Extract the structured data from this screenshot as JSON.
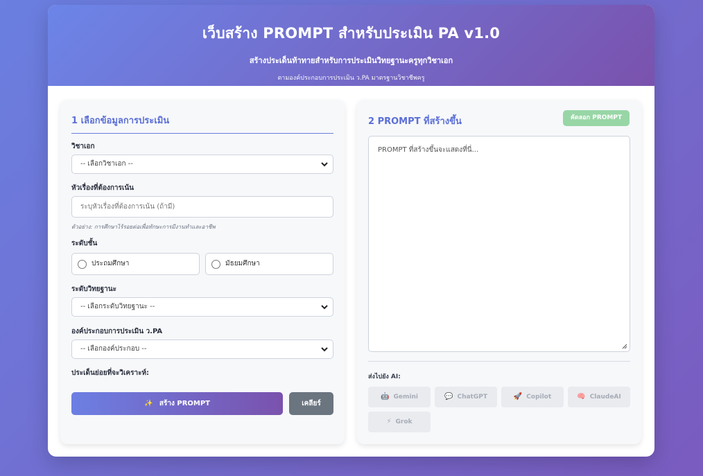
{
  "header": {
    "title": "เว็บสร้าง PROMPT สำหรับประเมิน PA v1.0",
    "subtitle": "สร้างประเด็นท้าทายสำหรับการประเมินวิทยฐานะครูทุกวิชาเอก",
    "description": "ตามองค์ประกอบการประเมิน ว.PA มาตรฐานวิชาชีพครู"
  },
  "form": {
    "section_title": "1 เลือกข้อมูลการประเมิน",
    "subject": {
      "label": "วิชาเอก",
      "value": "-- เลือกวิชาเอก --"
    },
    "topic": {
      "label": "หัวเรื่องที่ต้องการเน้น",
      "placeholder": "ระบุหัวเรื่องที่ต้องการเน้น (ถ้ามี)",
      "hint": "ตัวอย่าง: การศึกษาไร้รอยต่อเพื่อทักษะการมีงานทำและอาชีพ"
    },
    "level": {
      "label": "ระดับชั้น",
      "options": [
        "ประถมศึกษา",
        "มัธยมศึกษา"
      ]
    },
    "rank": {
      "label": "ระดับวิทยฐานะ",
      "value": "-- เลือกระดับวิทยฐานะ --"
    },
    "component": {
      "label": "องค์ประกอบการประเมิน ว.PA",
      "value": "-- เลือกองค์ประกอบ --"
    },
    "subtopics_label": "ประเด็นย่อยที่จะวิเคราะห์:",
    "generate_button": "สร้าง PROMPT",
    "generate_icon": "✨",
    "clear_button": "เคลียร์"
  },
  "output": {
    "section_title": "2 PROMPT ที่สร้างขึ้น",
    "copy_button": "คัดลอก PROMPT",
    "placeholder": "PROMPT ที่สร้างขึ้นจะแสดงที่นี่...",
    "send_label": "ส่งไปยัง AI:",
    "ai_buttons": [
      {
        "label": "Gemini",
        "icon": "🤖"
      },
      {
        "label": "ChatGPT",
        "icon": "💬"
      },
      {
        "label": "Copilot",
        "icon": "🚀"
      },
      {
        "label": "ClaudeAI",
        "icon": "🧠"
      },
      {
        "label": "Grok",
        "icon": "⚡"
      }
    ]
  },
  "colors": {
    "accent": "#5b6fd6",
    "copy_button": "#98d6a6",
    "clear_button": "#6b7580"
  }
}
